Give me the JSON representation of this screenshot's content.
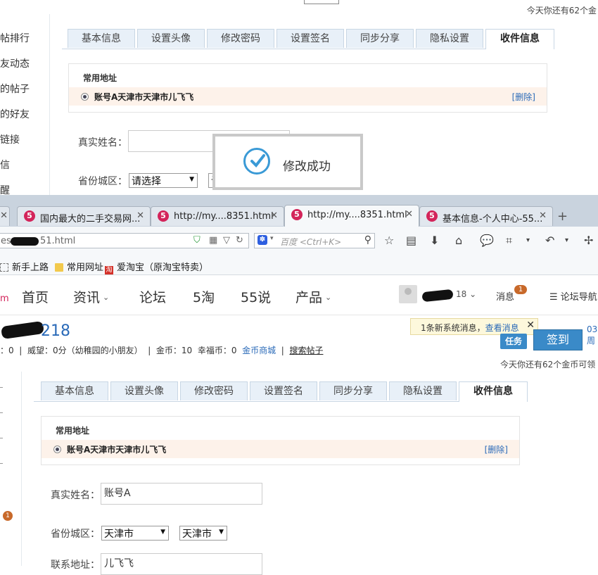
{
  "top_shot": {
    "coin_tip": "今天你还有62个金",
    "sidebar_items": [
      "帖排行",
      "友动态",
      "的帖子",
      "的好友",
      "链接",
      "信",
      "醒"
    ],
    "tabs": [
      "基本信息",
      "设置头像",
      "修改密码",
      "设置签名",
      "同步分享",
      "隐私设置",
      "收件信息"
    ],
    "active_tab": "收件信息",
    "address": {
      "title": "常用地址",
      "value": "账号A天津市天津市儿飞飞",
      "delete": "[删除]"
    },
    "real_name_label": "真实姓名：",
    "province_label": "省份城区：",
    "province_select": "请选择",
    "city_select_frag": "请",
    "toast_message": "修改成功"
  },
  "browser": {
    "tabs": [
      {
        "title": "国内最大的二手交易网...",
        "active": false
      },
      {
        "title": "http://my....8351.html",
        "active": false
      },
      {
        "title": "http://my....8351.html",
        "active": true
      },
      {
        "title": "基本信息-个人中心-55...",
        "active": false
      }
    ],
    "new_tab": "+",
    "url_prefix": "ess-",
    "url_suffix": "51.html",
    "search_placeholder": "百度 <Ctrl+K>",
    "bookmarks": [
      "新手上路",
      "常用网址",
      "爱淘宝（原淘宝特卖）"
    ]
  },
  "site": {
    "logo_frag": "m",
    "nav": [
      {
        "label": "首页",
        "chevron": false
      },
      {
        "label": "资讯",
        "chevron": true
      },
      {
        "label": "论坛",
        "chevron": false
      },
      {
        "label": "5淘",
        "chevron": false
      },
      {
        "label": "55说",
        "chevron": false
      },
      {
        "label": "产品",
        "chevron": true
      }
    ],
    "username_suffix": "18",
    "messages_label": "消息",
    "messages_count": "1",
    "forum_nav": "论坛导航"
  },
  "profile": {
    "name_suffix": "218",
    "stats_prefix": "：0",
    "stats_reputation": "威望：0分（幼稚园的小朋友）",
    "stats_coins": "金币：10",
    "stats_happy": "幸福币：0",
    "coin_mall": "金币商城",
    "search_posts": "搜索帖子",
    "notice_text": "1条新系统消息，",
    "notice_link": "查看消息",
    "task_label": "任务",
    "signin_label": "签到",
    "date_frag_1": "03",
    "date_frag_2": "周",
    "coin_tip": "今天你还有62个金币可领"
  },
  "bottom_shot": {
    "tabs": [
      "基本信息",
      "设置头像",
      "修改密码",
      "设置签名",
      "同步分享",
      "隐私设置",
      "收件信息"
    ],
    "active_tab": "收件信息",
    "address": {
      "title": "常用地址",
      "value": "账号A天津市天津市儿飞飞",
      "delete": "[删除]"
    },
    "real_name_label": "真实姓名：",
    "real_name_value": "账号A",
    "province_label": "省份城区：",
    "province_select": "天津市",
    "city_select": "天津市",
    "contact_label": "联系地址：",
    "contact_value": "儿飞飞",
    "side_badge": "1"
  },
  "colors": {
    "accent_blue": "#2a6ab8",
    "tab_bg": "#e8f0f8",
    "address_row_bg": "#fdf2ea",
    "brand_pink": "#d3245a",
    "badge_orange": "#c8692a"
  }
}
